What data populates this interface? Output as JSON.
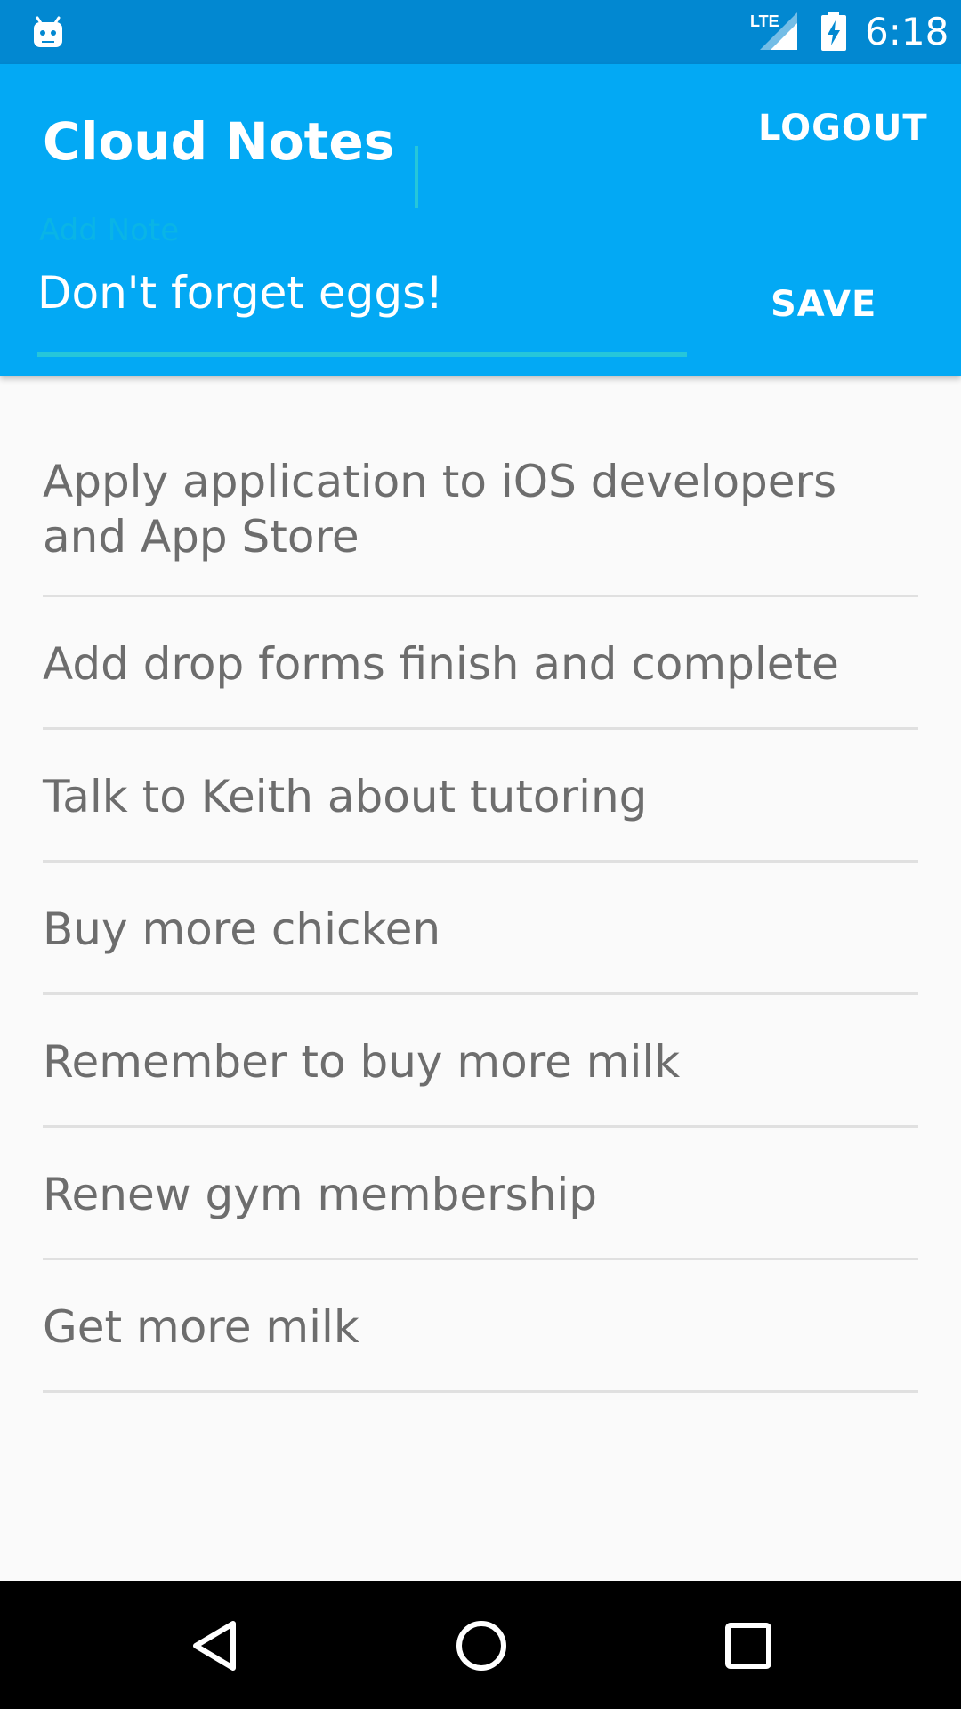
{
  "status_bar": {
    "time": "6:18",
    "network_label": "LTE",
    "icons": [
      "android-icon",
      "lte-signal-icon",
      "battery-charging-icon"
    ]
  },
  "app_bar": {
    "title": "Cloud Notes",
    "logout_label": "LOGOUT",
    "note_hint": "Add Note",
    "note_value": "Don't forget eggs!",
    "save_label": "SAVE"
  },
  "notes": [
    {
      "text": "Apply application to iOS developers and App Store"
    },
    {
      "text": "Add drop forms finish and complete"
    },
    {
      "text": "Talk to Keith about tutoring"
    },
    {
      "text": "Buy more chicken"
    },
    {
      "text": "Remember to buy more milk"
    },
    {
      "text": "Renew gym membership"
    },
    {
      "text": "Get more milk"
    }
  ],
  "nav_bar": {
    "icons": [
      "back-icon",
      "home-icon",
      "recents-icon"
    ]
  },
  "colors": {
    "status_bar": "#0288d1",
    "app_bar": "#03a9f4",
    "accent": "#26c6da",
    "list_text": "#6d6d6d",
    "divider": "#e0e0e0",
    "background": "#fafafa"
  }
}
